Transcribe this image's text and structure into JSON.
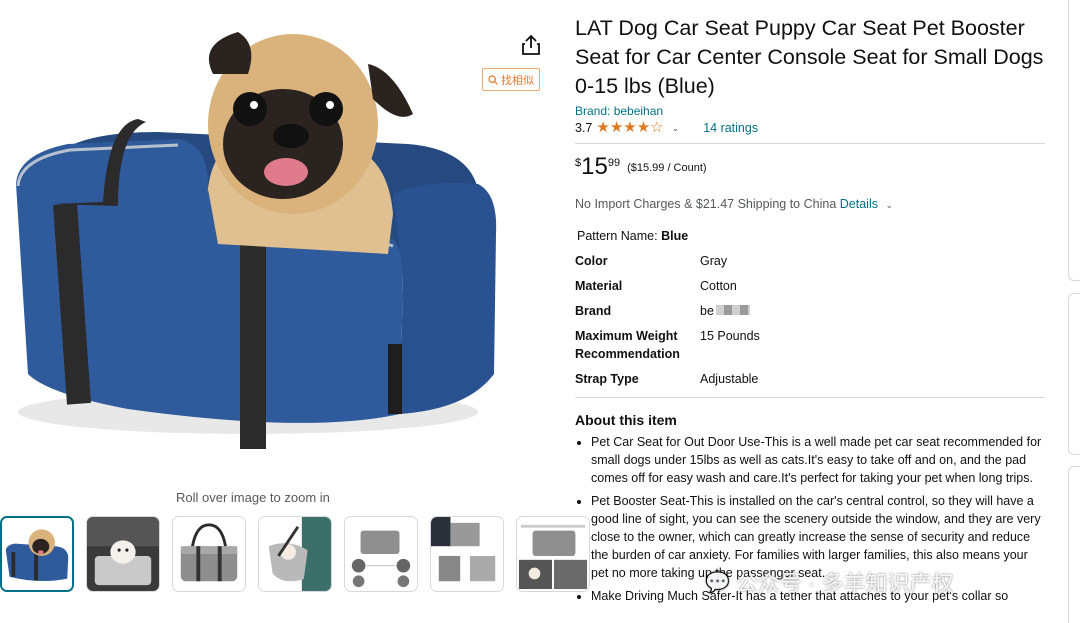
{
  "gallery": {
    "zoom_hint": "Roll over image to zoom in",
    "find_similar_label": "找相似",
    "share_icon": "share-icon",
    "thumbnails": [
      "blue-seat-pug",
      "seat-in-car-dog",
      "gray-seat-handles",
      "seat-carried",
      "gray-seat-features",
      "seat-dimensions",
      "seat-installation"
    ]
  },
  "product": {
    "title": "LAT Dog Car Seat Puppy Car Seat Pet Booster Seat for Car Center Console Seat for Small Dogs 0-15 lbs (Blue)",
    "brand_label": "Brand: bebeihan",
    "rating_value": "3.7",
    "stars_display": "★★★★☆",
    "ratings_count": "14 ratings",
    "price_symbol": "$",
    "price_whole": "15",
    "price_fraction": "99",
    "unit_price": "($15.99 / Count)",
    "shipping_text": "No Import Charges & $21.47 Shipping to China",
    "shipping_details_link": "Details",
    "pattern_label": "Pattern Name:",
    "pattern_value": "Blue"
  },
  "specs": [
    {
      "key": "Color",
      "value": "Gray"
    },
    {
      "key": "Material",
      "value": "Cotton"
    },
    {
      "key": "Brand",
      "value": "be"
    },
    {
      "key": "Maximum Weight Recommendation",
      "value": "15 Pounds"
    },
    {
      "key": "Strap Type",
      "value": "Adjustable"
    }
  ],
  "about": {
    "heading": "About this item",
    "bullets": [
      "Pet Car Seat for Out Door Use-This is a well made pet car seat recommended for small dogs under 15lbs as well as cats.It's easy to take off and on, and the pad comes off for easy wash and care.It's perfect for taking your pet when long trips.",
      "Pet Booster Seat-This is installed on the car's central control, so they will have a good line of sight, you can see the scenery outside the window, and they are very close to the owner, which can greatly increase the sense of security and reduce the burden of car anxiety. For families with larger families, this also means your pet no more taking up the passenger seat.",
      "Make Driving Much Safer-It has a tether that attaches to your pet's collar so"
    ]
  },
  "watermark": "公众号 · 多羊知识产权",
  "colors": {
    "link": "#007185",
    "star": "#de7921",
    "seat_blue": "#2f5b9c",
    "strap": "#2b2b2b"
  }
}
